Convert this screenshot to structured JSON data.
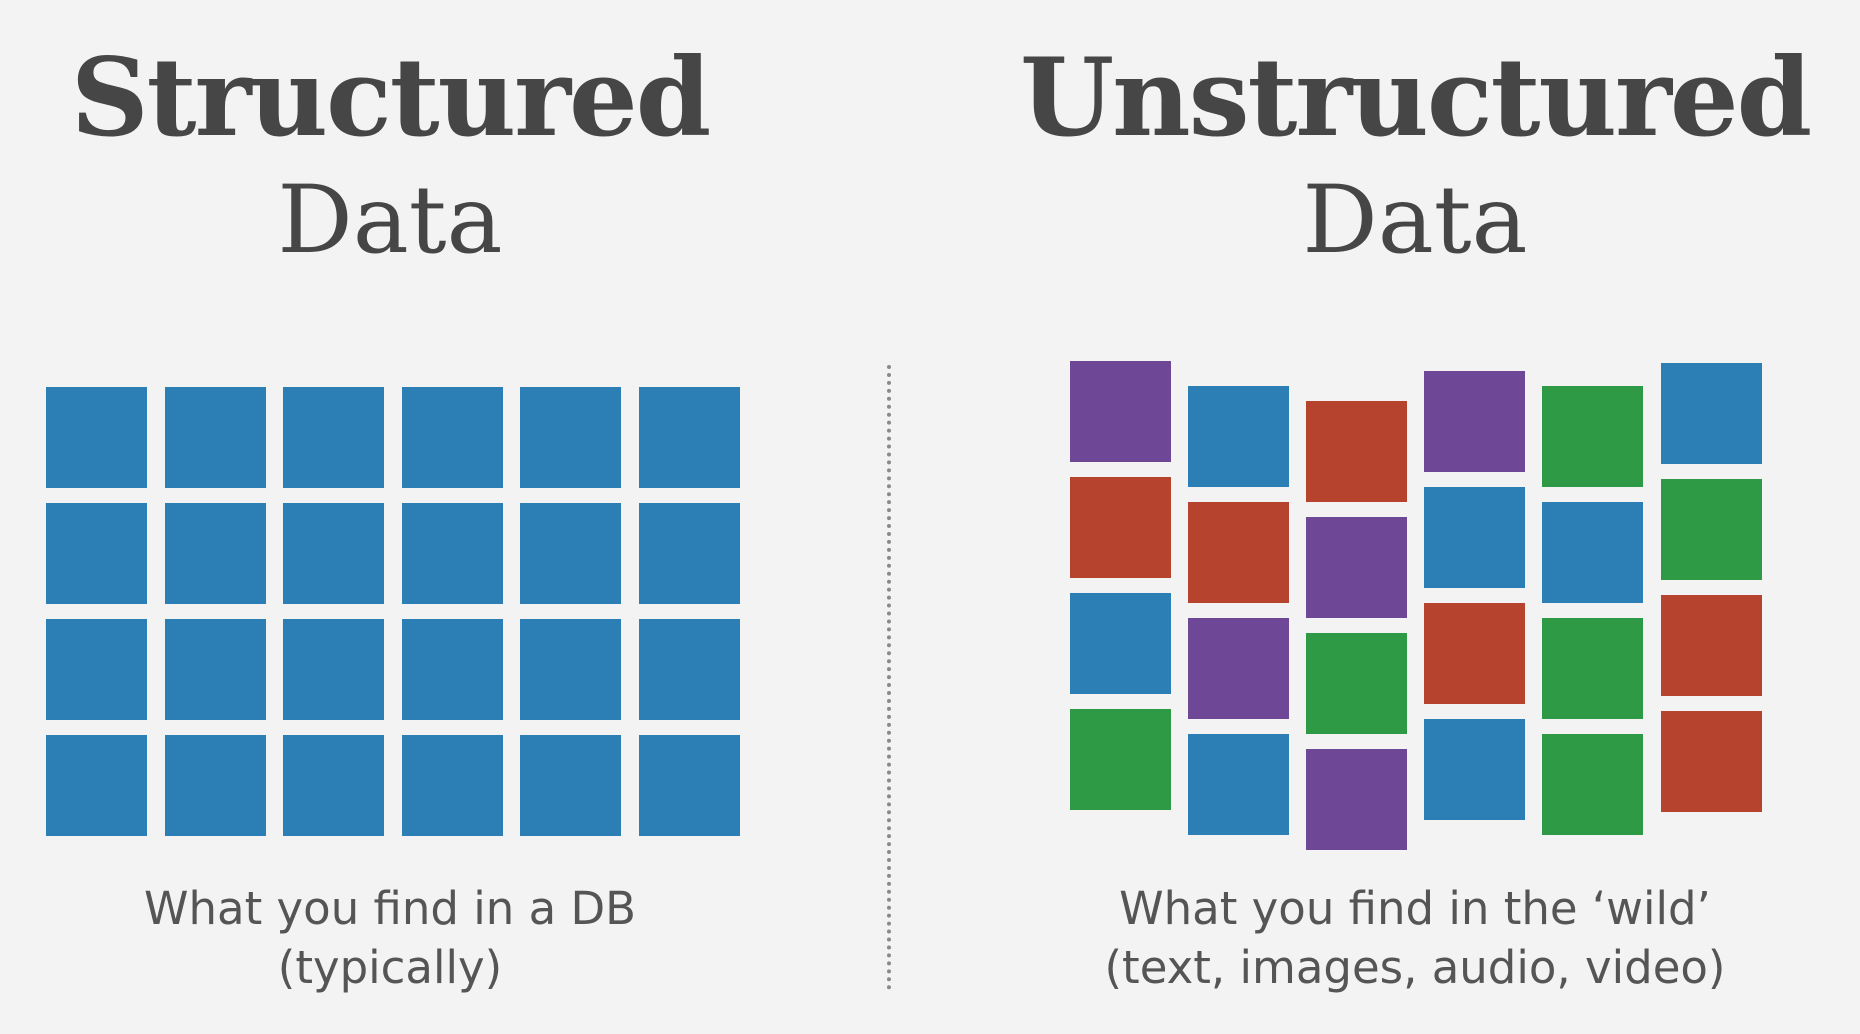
{
  "left": {
    "title_bold": "Structured",
    "title_light": "Data",
    "caption_line1": "What you find in a DB",
    "caption_line2": "(typically)",
    "grid": {
      "columns": 6,
      "rows": 4,
      "color": "#2b7fb4"
    }
  },
  "right": {
    "title_bold": "Unstructured",
    "title_light": "Data",
    "caption_line1": "What you find in the ‘wild’",
    "caption_line2": "(text, images, audio, video)",
    "columns": [
      [
        "purple",
        "red",
        "blue",
        "green"
      ],
      [
        "blue",
        "red",
        "purple",
        "blue"
      ],
      [
        "red",
        "purple",
        "green",
        "purple"
      ],
      [
        "purple",
        "blue",
        "red",
        "blue"
      ],
      [
        "green",
        "blue",
        "green",
        "green"
      ],
      [
        "blue",
        "green",
        "red",
        "red"
      ]
    ]
  },
  "colors": {
    "blue": "#2b7fb4",
    "red": "#b5432e",
    "purple": "#6e4796",
    "green": "#2e9a45",
    "background": "#f3f3f3"
  }
}
